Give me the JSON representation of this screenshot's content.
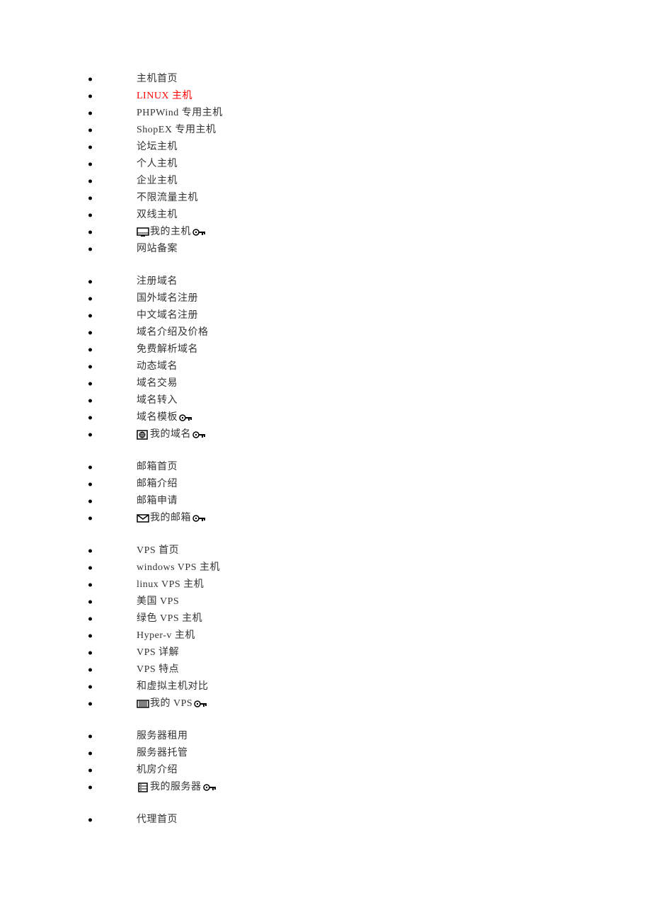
{
  "groups": [
    {
      "id": "hosting",
      "items": [
        {
          "label": "主机首页",
          "highlight": false,
          "leadIcon": null,
          "trailKey": false
        },
        {
          "label": "LINUX 主机",
          "highlight": true,
          "leadIcon": null,
          "trailKey": false
        },
        {
          "label": "PHPWind 专用主机",
          "highlight": false,
          "leadIcon": null,
          "trailKey": false
        },
        {
          "label": "ShopEX 专用主机",
          "highlight": false,
          "leadIcon": null,
          "trailKey": false
        },
        {
          "label": "论坛主机",
          "highlight": false,
          "leadIcon": null,
          "trailKey": false
        },
        {
          "label": "个人主机",
          "highlight": false,
          "leadIcon": null,
          "trailKey": false
        },
        {
          "label": "企业主机",
          "highlight": false,
          "leadIcon": null,
          "trailKey": false
        },
        {
          "label": "不限流量主机",
          "highlight": false,
          "leadIcon": null,
          "trailKey": false
        },
        {
          "label": "双线主机",
          "highlight": false,
          "leadIcon": null,
          "trailKey": false
        },
        {
          "label": "我的主机",
          "highlight": false,
          "leadIcon": "monitor",
          "trailKey": true
        },
        {
          "label": "网站备案",
          "highlight": false,
          "leadIcon": null,
          "trailKey": false
        }
      ]
    },
    {
      "id": "domain",
      "items": [
        {
          "label": "注册域名",
          "highlight": false,
          "leadIcon": null,
          "trailKey": false
        },
        {
          "label": "国外域名注册",
          "highlight": false,
          "leadIcon": null,
          "trailKey": false
        },
        {
          "label": "中文域名注册",
          "highlight": false,
          "leadIcon": null,
          "trailKey": false
        },
        {
          "label": "域名介绍及价格",
          "highlight": false,
          "leadIcon": null,
          "trailKey": false
        },
        {
          "label": "免费解析域名",
          "highlight": false,
          "leadIcon": null,
          "trailKey": false
        },
        {
          "label": "动态域名",
          "highlight": false,
          "leadIcon": null,
          "trailKey": false
        },
        {
          "label": "域名交易",
          "highlight": false,
          "leadIcon": null,
          "trailKey": false
        },
        {
          "label": "域名转入",
          "highlight": false,
          "leadIcon": null,
          "trailKey": false
        },
        {
          "label": "域名模板",
          "highlight": false,
          "leadIcon": null,
          "trailKey": true
        },
        {
          "label": "我的域名",
          "highlight": false,
          "leadIcon": "globe",
          "trailKey": true
        }
      ]
    },
    {
      "id": "mail",
      "items": [
        {
          "label": "邮箱首页",
          "highlight": false,
          "leadIcon": null,
          "trailKey": false
        },
        {
          "label": "邮箱介绍",
          "highlight": false,
          "leadIcon": null,
          "trailKey": false
        },
        {
          "label": "邮箱申请",
          "highlight": false,
          "leadIcon": null,
          "trailKey": false
        },
        {
          "label": "我的邮箱",
          "highlight": false,
          "leadIcon": "envelope",
          "trailKey": true
        }
      ]
    },
    {
      "id": "vps",
      "items": [
        {
          "label": "VPS 首页",
          "highlight": false,
          "leadIcon": null,
          "trailKey": false
        },
        {
          "label": "windows VPS 主机",
          "highlight": false,
          "leadIcon": null,
          "trailKey": false
        },
        {
          "label": "linux VPS 主机",
          "highlight": false,
          "leadIcon": null,
          "trailKey": false
        },
        {
          "label": "美国 VPS",
          "highlight": false,
          "leadIcon": null,
          "trailKey": false
        },
        {
          "label": "绿色 VPS 主机",
          "highlight": false,
          "leadIcon": null,
          "trailKey": false
        },
        {
          "label": "Hyper-v 主机",
          "highlight": false,
          "leadIcon": null,
          "trailKey": false
        },
        {
          "label": "VPS 详解",
          "highlight": false,
          "leadIcon": null,
          "trailKey": false
        },
        {
          "label": "VPS 特点",
          "highlight": false,
          "leadIcon": null,
          "trailKey": false
        },
        {
          "label": "和虚拟主机对比",
          "highlight": false,
          "leadIcon": null,
          "trailKey": false
        },
        {
          "label": "我的 VPS",
          "highlight": false,
          "leadIcon": "rack",
          "trailKey": true
        }
      ]
    },
    {
      "id": "server",
      "items": [
        {
          "label": "服务器租用",
          "highlight": false,
          "leadIcon": null,
          "trailKey": false
        },
        {
          "label": "服务器托管",
          "highlight": false,
          "leadIcon": null,
          "trailKey": false
        },
        {
          "label": "机房介绍",
          "highlight": false,
          "leadIcon": null,
          "trailKey": false
        },
        {
          "label": "我的服务器",
          "highlight": false,
          "leadIcon": "server",
          "trailKey": true
        }
      ]
    },
    {
      "id": "agent",
      "items": [
        {
          "label": "代理首页",
          "highlight": false,
          "leadIcon": null,
          "trailKey": false
        }
      ]
    }
  ],
  "icons": {
    "monitor": "monitor-icon",
    "globe": "globe-icon",
    "envelope": "envelope-icon",
    "rack": "rack-icon",
    "server": "server-icon",
    "key": "key-icon"
  }
}
